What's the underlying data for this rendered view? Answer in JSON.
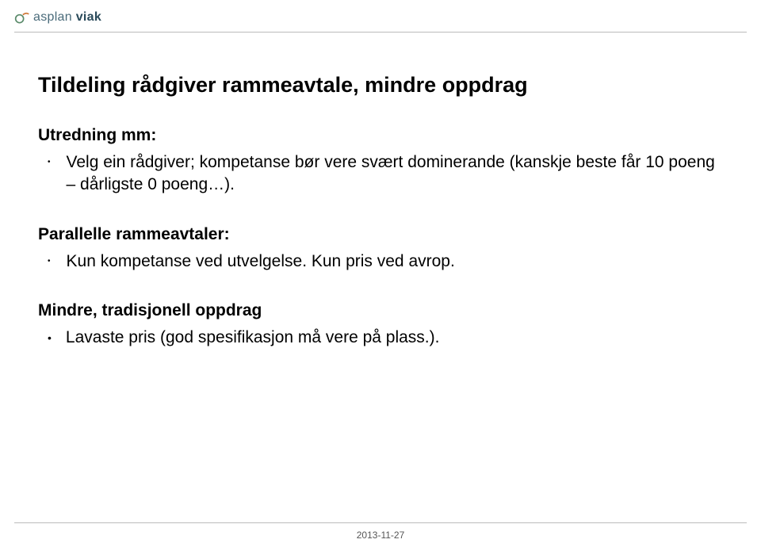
{
  "logo": {
    "brand_part1": "asplan",
    "brand_part2": " viak"
  },
  "slide": {
    "title": "Tildeling rådgiver rammeavtale, mindre oppdrag",
    "section1": {
      "heading": "Utredning mm:",
      "bullet": "Velg ein rådgiver; kompetanse bør vere svært dominerande (kanskje beste får 10 poeng – dårligste 0 poeng…)."
    },
    "section2": {
      "heading": "Parallelle rammeavtaler:",
      "bullet": "Kun kompetanse ved utvelgelse. Kun pris ved avrop."
    },
    "section3": {
      "heading": "Mindre, tradisjonell oppdrag",
      "bullet": "Lavaste pris (god spesifikasjon må vere på plass.)."
    }
  },
  "footer": {
    "date": "2013-11-27"
  }
}
